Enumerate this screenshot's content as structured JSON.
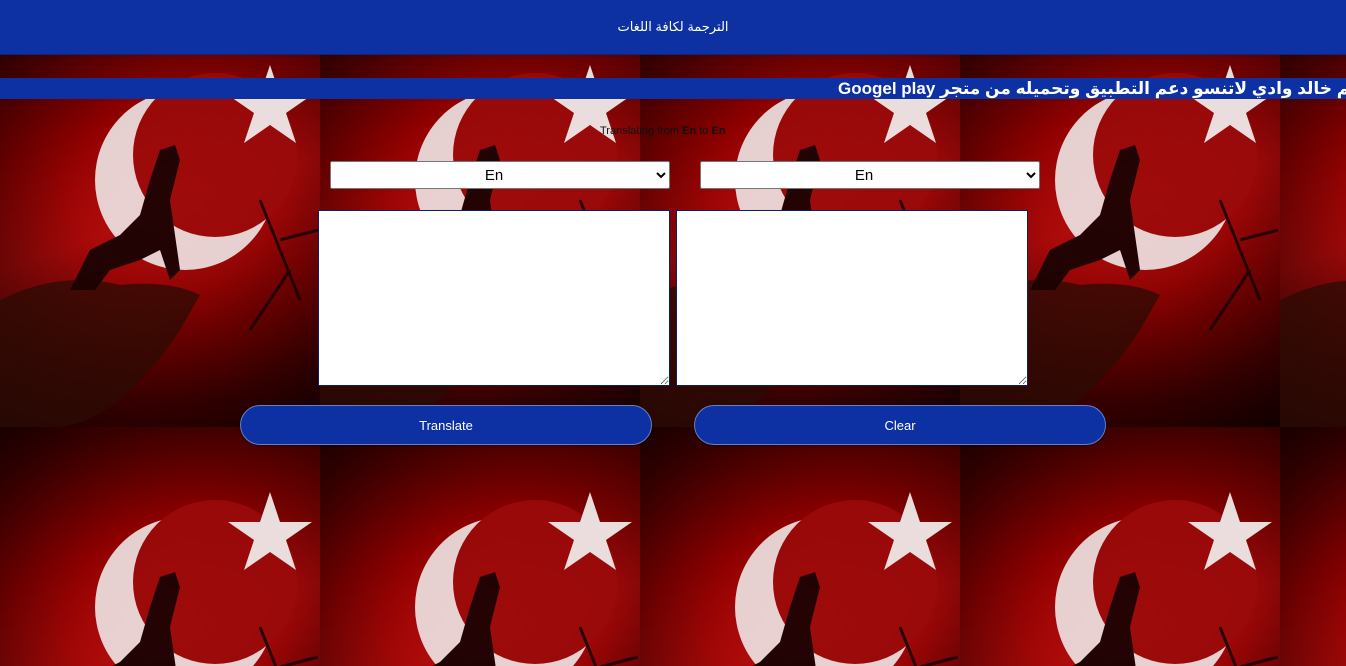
{
  "header": {
    "title": "الترجمة لكافة اللغات"
  },
  "marquee": {
    "text": "معكم خالد وادي لاتنسو دعم التطبيق وتحميله من متجر Googel play"
  },
  "status": {
    "prefix": "Translating from",
    "from": "En",
    "middle": "to",
    "to": "En"
  },
  "from_language": {
    "selected": "En"
  },
  "to_language": {
    "selected": "En"
  },
  "source": {
    "value": ""
  },
  "target": {
    "value": ""
  },
  "buttons": {
    "translate_label": "Translate",
    "clear_label": "Clear"
  },
  "colors": {
    "primary": "#0d30a2",
    "background": "#8a0000"
  },
  "background": {
    "motif": [
      "crescent-icon",
      "star-icon",
      "wolf-silhouette"
    ]
  }
}
